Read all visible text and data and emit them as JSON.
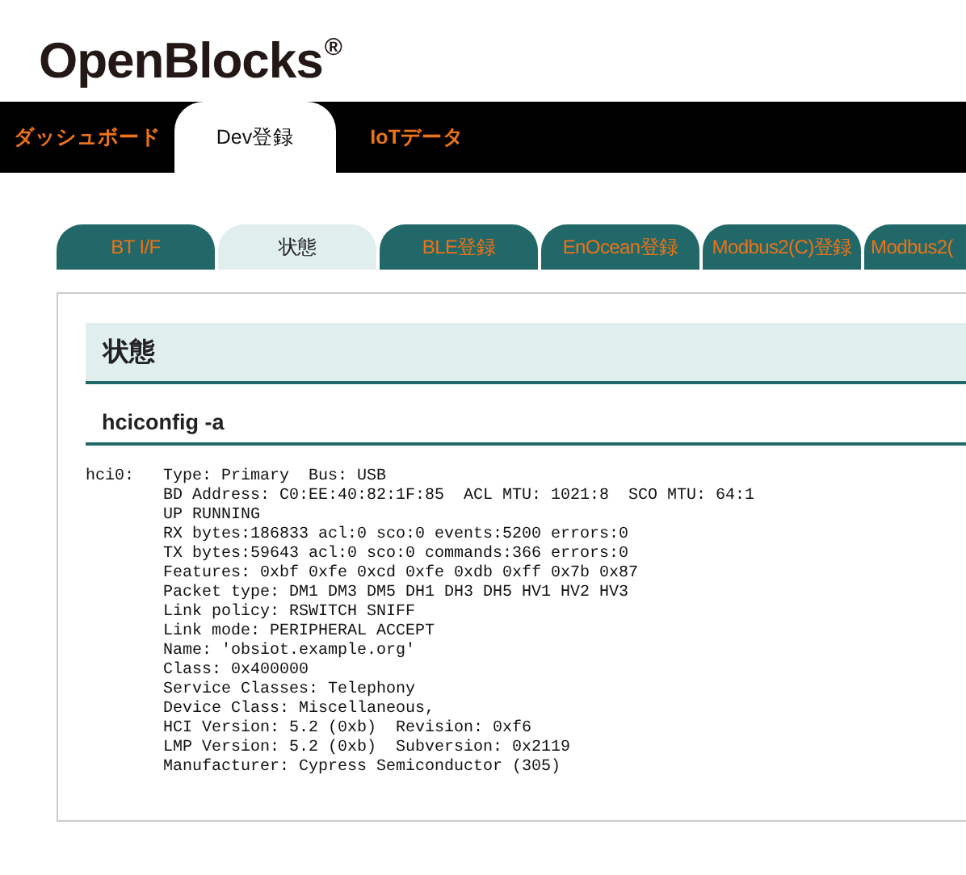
{
  "logo": {
    "name": "OpenBlocks",
    "mark": "®"
  },
  "nav": [
    {
      "label": "ダッシュボード",
      "selected": false
    },
    {
      "label": "Dev登録",
      "selected": true
    },
    {
      "label": "IoTデータ",
      "selected": false
    }
  ],
  "subtabs": [
    {
      "label": "BT I/F",
      "selected": false
    },
    {
      "label": "状態",
      "selected": true
    },
    {
      "label": "BLE登録",
      "selected": false
    },
    {
      "label": "EnOcean登録",
      "selected": false
    },
    {
      "label": "Modbus2(C)登録",
      "selected": false
    },
    {
      "label": "Modbus2(",
      "selected": false
    }
  ],
  "panel": {
    "title": "状態",
    "command": "hciconfig -a",
    "device": "hci0:",
    "lines": [
      "Type: Primary  Bus: USB",
      "BD Address: C0:EE:40:82:1F:85  ACL MTU: 1021:8  SCO MTU: 64:1",
      "UP RUNNING",
      "RX bytes:186833 acl:0 sco:0 events:5200 errors:0",
      "TX bytes:59643 acl:0 sco:0 commands:366 errors:0",
      "Features: 0xbf 0xfe 0xcd 0xfe 0xdb 0xff 0x7b 0x87",
      "Packet type: DM1 DM3 DM5 DH1 DH3 DH5 HV1 HV2 HV3",
      "Link policy: RSWITCH SNIFF",
      "Link mode: PERIPHERAL ACCEPT",
      "Name: 'obsiot.example.org'",
      "Class: 0x400000",
      "Service Classes: Telephony",
      "Device Class: Miscellaneous,",
      "HCI Version: 5.2 (0xb)  Revision: 0xf6",
      "LMP Version: 5.2 (0xb)  Subversion: 0x2119",
      "Manufacturer: Cypress Semiconductor (305)"
    ]
  }
}
